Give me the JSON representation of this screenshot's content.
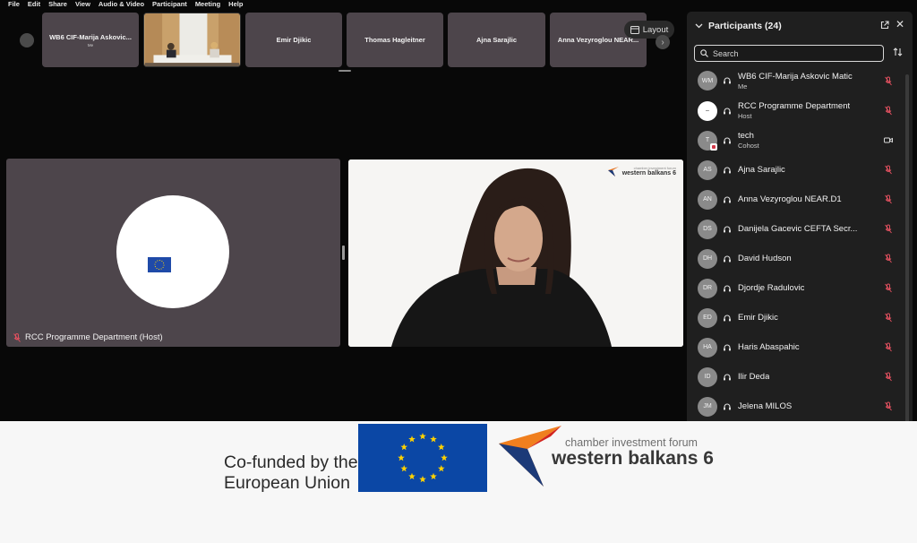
{
  "menubar": [
    "File",
    "Edit",
    "Share",
    "View",
    "Audio & Video",
    "Participant",
    "Meeting",
    "Help"
  ],
  "strip": {
    "thumbnails": [
      {
        "name": "WB6 CIF-Marija Askovic...",
        "sub": "Me"
      },
      {
        "name": "Emir Djikic"
      },
      {
        "name": "Thomas Hagleitner"
      },
      {
        "name": "Ajna Sarajlic"
      },
      {
        "name": "Anna Vezyroglou NEAR..."
      }
    ],
    "layout_label": "Layout"
  },
  "host_tile": {
    "label": "RCC Programme Department (Host)"
  },
  "speaker_tile": {
    "logo_small": "chamber investment forum",
    "logo_big": "western balkans 6"
  },
  "panel": {
    "title": "Participants (24)",
    "search_placeholder": "Search",
    "participants": [
      {
        "initials": "WM",
        "name": "WB6 CIF-Marija Askovic Matic",
        "role": "Me",
        "status": "muted"
      },
      {
        "initials": "–",
        "name": "RCC Programme Department",
        "role": "Host",
        "status": "muted"
      },
      {
        "initials": "T",
        "name": "tech",
        "role": "Cohost",
        "status": "video"
      },
      {
        "initials": "AS",
        "name": "Ajna Sarajlic",
        "status": "muted"
      },
      {
        "initials": "AN",
        "name": "Anna Vezyroglou NEAR.D1",
        "status": "muted"
      },
      {
        "initials": "DS",
        "name": "Danijela Gacevic CEFTA Secr...",
        "status": "muted"
      },
      {
        "initials": "DH",
        "name": "David Hudson",
        "status": "muted"
      },
      {
        "initials": "DR",
        "name": "Djordje Radulovic",
        "status": "muted"
      },
      {
        "initials": "ED",
        "name": "Emir Djikic",
        "status": "muted"
      },
      {
        "initials": "HA",
        "name": "Haris Abaspahic",
        "status": "muted"
      },
      {
        "initials": "ID",
        "name": "Ilir Deda",
        "status": "muted"
      },
      {
        "initials": "JM",
        "name": "Jelena MILOS",
        "status": "muted"
      }
    ]
  },
  "banner": {
    "eu_line1": "Co-funded by the",
    "eu_line2": "European Union",
    "wb_small": "chamber investment forum",
    "wb_big": "western balkans 6"
  },
  "colors": {
    "tile": "#4d454b",
    "panel": "#1f1f1f",
    "eu_blue": "#0b47a5",
    "eu_gold": "#ffd200",
    "mute_red": "#e0505f"
  }
}
